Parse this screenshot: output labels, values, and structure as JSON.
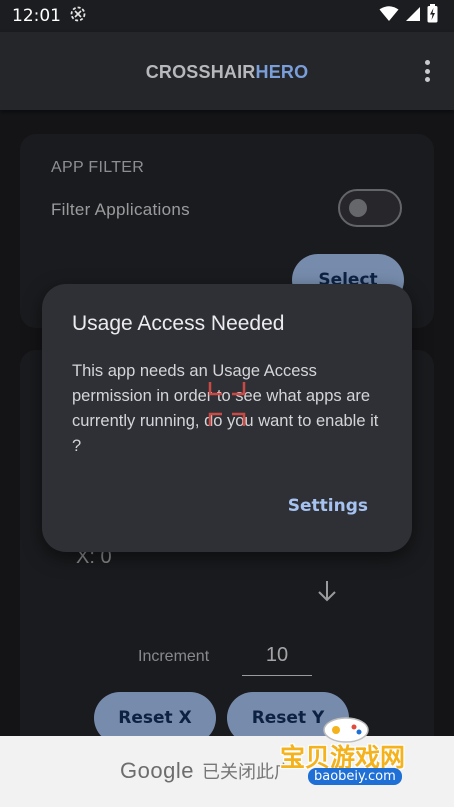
{
  "status_bar": {
    "time": "12:01",
    "icons": [
      "sync-icon",
      "wifi-icon",
      "signal-icon",
      "battery-icon"
    ]
  },
  "app_bar": {
    "title_part1": "CROSSHAIR",
    "title_part2": "HERO",
    "menu_icon": "overflow-menu-icon"
  },
  "app_filter": {
    "section_label": "APP FILTER",
    "toggle_label": "Filter Applications",
    "toggle_on": false,
    "select_label": "Select"
  },
  "position": {
    "x_readout": "X: 0",
    "increment_label": "Increment",
    "increment_value": "10",
    "reset_x_label": "Reset X",
    "reset_y_label": "Reset Y"
  },
  "dialog": {
    "title": "Usage Access Needed",
    "message": "This app needs an Usage Access permission in order to see what apps are currently running, do you want to enable it ?",
    "settings_label": "Settings"
  },
  "ad_bar": {
    "google_label": "Google",
    "closed_label": "已关闭此广"
  },
  "watermark": {
    "name": "宝贝游戏网",
    "url": "baobeiy.com"
  },
  "colors": {
    "background": "#1c1d20",
    "card": "#25262a",
    "dialog": "#2f3035",
    "accent_button": "#a6c2f0",
    "accent_text": "#a6c2f0",
    "title_hero": "#7a9ed9",
    "crosshair": "#c94a44"
  }
}
